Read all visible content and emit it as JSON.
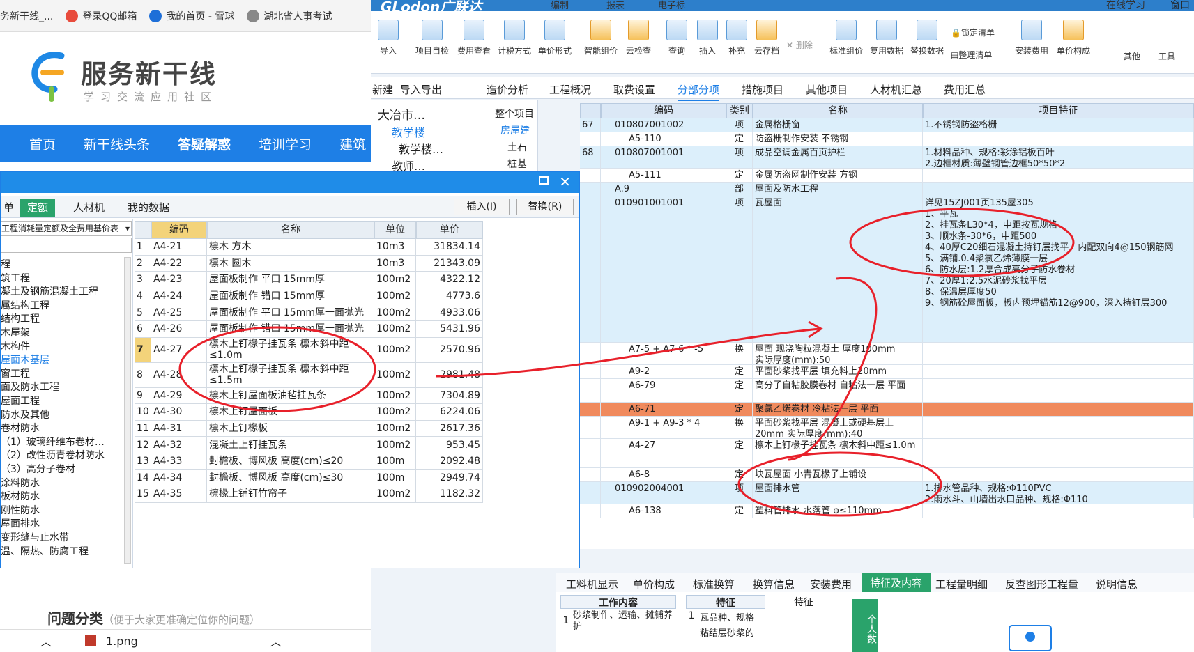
{
  "browser": {
    "bookmarks": [
      "务新干线_...",
      "登录QQ邮箱",
      "我的首页 - 雪球",
      "湖北省人事考试"
    ],
    "logo_title": "服务新干线",
    "logo_sub": "学习交流应用社区",
    "nav": [
      "首页",
      "新干线头条",
      "答疑解惑",
      "培训学习",
      "建筑"
    ],
    "cat_title": "问题分类",
    "cat_hint": "（便于大家更准确定位你的问题）",
    "download": "1.png"
  },
  "glodon": {
    "brand": "GLodon广联达",
    "top_tabs": [
      "编制",
      "报表",
      "电子标"
    ],
    "online": "在线学习",
    "window": "窗口",
    "ribbon": [
      "导入",
      "项目自检",
      "费用查看",
      "计税方式",
      "单价形式",
      "智能组价",
      "云检查",
      "查询",
      "插入",
      "补充",
      "云存档",
      "删除",
      "标准组价",
      "复用数据",
      "替换数据",
      "锁定清单",
      "整理清单",
      "安装费用",
      "单价构成",
      "其他",
      "工具"
    ],
    "left_strip": [
      "新建",
      "导入导出"
    ],
    "nav_tabs": [
      "造价分析",
      "工程概况",
      "取费设置",
      "分部分项",
      "措施项目",
      "其他项目",
      "人材机汇总",
      "费用汇总"
    ],
    "tree": [
      "大冶市…",
      "教学楼",
      "教学楼…",
      "教师…"
    ],
    "tree2": [
      "整个项目",
      "房屋建",
      "土石",
      "桩基"
    ],
    "grid_headers": [
      "编码",
      "类别",
      "名称",
      "项目特征"
    ],
    "rows": [
      {
        "no": "67",
        "code": "010807001002",
        "type": "项",
        "name": "金属格栅窗",
        "feat": "1.不锈钢防盗格栅"
      },
      {
        "no": "",
        "code": "A5-110",
        "type": "定",
        "name": "防盗栅制作安装 不锈钢",
        "feat": ""
      },
      {
        "no": "68",
        "code": "010807001001",
        "type": "项",
        "name": "成品空调金属百页护栏",
        "feat": "1.材料品种、规格:彩涂铝板百叶\n2.边框材质:薄壁钢管边框50*50*2"
      },
      {
        "no": "",
        "code": "A5-111",
        "type": "定",
        "name": "金属防盗网制作安装 方钢",
        "feat": ""
      },
      {
        "no": "",
        "code": "A.9",
        "type": "部",
        "name": "屋面及防水工程",
        "feat": ""
      },
      {
        "no": "",
        "code": "010901001001",
        "type": "项",
        "name": "瓦屋面",
        "feat": "详见15ZJ001页135屋305\n1、平瓦\n2、挂瓦条L30*4，中距按瓦规格\n3、顺水条-30*6，中距500\n4、40厚C20细石混凝土持钉层找平，内配双向4@150钢筋网\n5、满铺.0.4聚氯乙烯薄膜一层\n6、防水层:1.2厚合成高分子防水卷材\n7、20厚1:2.5水泥砂浆找平层\n8、保温层厚度50\n9、钢筋砼屋面板，板内预埋锚筋12@900，深入持钉层300"
      },
      {
        "no": "",
        "code": "A7-5 + A7-6 * -5",
        "type": "换",
        "name": "屋面 现浇陶粒混凝土 厚度100mm\n实际厚度(mm):50",
        "feat": ""
      },
      {
        "no": "",
        "code": "A9-2",
        "type": "定",
        "name": "平面砂浆找平层 填充料上20mm",
        "feat": ""
      },
      {
        "no": "",
        "code": "A6-79",
        "type": "定",
        "name": "高分子自粘胶膜卷材 自粘法一层 平面",
        "feat": ""
      },
      {
        "no": "",
        "code": "A6-71",
        "type": "定",
        "name": "聚氯乙烯卷材 冷粘法一层 平面",
        "feat": ""
      },
      {
        "no": "",
        "code": "A9-1 + A9-3 * 4",
        "type": "换",
        "name": "平面砂浆找平层 混凝土或硬基层上20mm 实际厚度(mm):40",
        "feat": ""
      },
      {
        "no": "",
        "code": "A4-27",
        "type": "定",
        "name": "檩木上钉椽子挂瓦条 檩木斜中距≤1.0m",
        "feat": ""
      },
      {
        "no": "",
        "code": "A6-8",
        "type": "定",
        "name": "块瓦屋面 小青瓦椽子上铺设",
        "feat": ""
      },
      {
        "no": "",
        "code": "010902004001",
        "type": "项",
        "name": "屋面排水管",
        "feat": "1.排水管品种、规格:Φ110PVC\n2.雨水斗、山墙出水口品种、规格:Φ110"
      },
      {
        "no": "",
        "code": "A6-138",
        "type": "定",
        "name": "塑料管排水 水落管 φ≤110mm",
        "feat": ""
      }
    ],
    "bottom_tabs": [
      "工料机显示",
      "单价构成",
      "标准换算",
      "换算信息",
      "安装费用",
      "特征及内容",
      "工程量明细",
      "反查图形工程量",
      "说明信息"
    ],
    "work_header": "工作内容",
    "work_text": "砂浆制作、运输、摊铺养护",
    "feat_header": "特征",
    "feat_header2": "特征",
    "feat_rows": [
      "瓦品种、规格",
      "粘结层砂浆的"
    ],
    "side_btn": "个人数"
  },
  "dialog": {
    "tabs": [
      "单",
      "定额",
      "人材机",
      "我的数据"
    ],
    "insert_btn": "插入(I)",
    "replace_btn": "替换(R)",
    "lib": "工程消耗量定额及全费用基价表",
    "left_items": [
      "程",
      "筑工程",
      "凝土及钢筋混凝土工程",
      "属结构工程",
      "结构工程",
      "木屋架",
      "木构件",
      "屋面木基层",
      "窗工程",
      "面及防水工程",
      "屋面工程",
      "防水及其他",
      "卷材防水",
      "（1）玻璃纤维布卷材…",
      "（2）改性沥青卷材防水",
      "（3）高分子卷材",
      "涂料防水",
      "板材防水",
      "刚性防水",
      "屋面排水",
      "变形缝与止水带",
      "温、隔热、防腐工程"
    ],
    "headers": [
      "编码",
      "名称",
      "单位",
      "单价"
    ],
    "rows": [
      {
        "no": "1",
        "code": "A4-21",
        "name": "檩木 方木",
        "unit": "10m3",
        "price": "31834.14"
      },
      {
        "no": "2",
        "code": "A4-22",
        "name": "檩木 圆木",
        "unit": "10m3",
        "price": "21343.09"
      },
      {
        "no": "3",
        "code": "A4-23",
        "name": "屋面板制作 平口 15mm厚",
        "unit": "100m2",
        "price": "4322.12"
      },
      {
        "no": "4",
        "code": "A4-24",
        "name": "屋面板制作 错口 15mm厚",
        "unit": "100m2",
        "price": "4773.6"
      },
      {
        "no": "5",
        "code": "A4-25",
        "name": "屋面板制作 平口 15mm厚一面抛光",
        "unit": "100m2",
        "price": "4933.06"
      },
      {
        "no": "6",
        "code": "A4-26",
        "name": "屋面板制作 错口 15mm厚一面抛光",
        "unit": "100m2",
        "price": "5431.96"
      },
      {
        "no": "7",
        "code": "A4-27",
        "name": "檩木上钉椽子挂瓦条 檩木斜中距≤1.0m",
        "unit": "100m2",
        "price": "2570.96"
      },
      {
        "no": "8",
        "code": "A4-28",
        "name": "檩木上钉椽子挂瓦条 檩木斜中距≤1.5m",
        "unit": "100m2",
        "price": "2981.48"
      },
      {
        "no": "9",
        "code": "A4-29",
        "name": "檩木上钉屋面板油毡挂瓦条",
        "unit": "100m2",
        "price": "7304.89"
      },
      {
        "no": "10",
        "code": "A4-30",
        "name": "檩木上钉屋面板",
        "unit": "100m2",
        "price": "6224.06"
      },
      {
        "no": "11",
        "code": "A4-31",
        "name": "檩木上钉椽板",
        "unit": "100m2",
        "price": "2617.36"
      },
      {
        "no": "12",
        "code": "A4-32",
        "name": "混凝土上钉挂瓦条",
        "unit": "100m2",
        "price": "953.45"
      },
      {
        "no": "13",
        "code": "A4-33",
        "name": "封檐板、博风板 高度(cm)≤20",
        "unit": "100m",
        "price": "2092.48"
      },
      {
        "no": "14",
        "code": "A4-34",
        "name": "封檐板、博风板 高度(cm)≤30",
        "unit": "100m",
        "price": "2949.74"
      },
      {
        "no": "15",
        "code": "A4-35",
        "name": "檩椽上铺钉竹帘子",
        "unit": "100m2",
        "price": "1182.32"
      }
    ]
  }
}
